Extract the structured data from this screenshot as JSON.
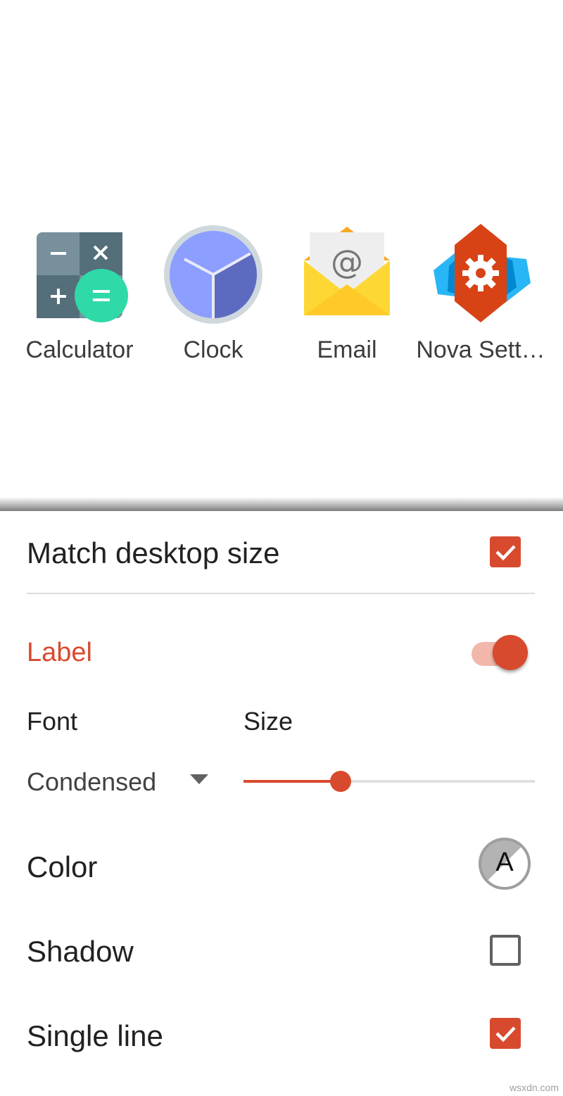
{
  "apps": [
    {
      "label": "Calculator",
      "icon": "calculator-icon"
    },
    {
      "label": "Clock",
      "icon": "clock-icon"
    },
    {
      "label": "Email",
      "icon": "email-icon"
    },
    {
      "label": "Nova Sett…",
      "icon": "nova-settings-icon"
    }
  ],
  "settings": {
    "match_desktop_size": {
      "label": "Match desktop size",
      "checked": true
    },
    "label_section": {
      "label": "Label",
      "enabled": true
    },
    "font": {
      "heading": "Font",
      "value": "Condensed",
      "icon": "dropdown-arrow-icon"
    },
    "size": {
      "heading": "Size",
      "fraction": 0.33
    },
    "color": {
      "label": "Color",
      "swatch_text": "A"
    },
    "shadow": {
      "label": "Shadow",
      "checked": false
    },
    "single_line": {
      "label": "Single line",
      "checked": true
    }
  },
  "watermark": "wsxdn.com",
  "colors": {
    "accent": "#d84a2e",
    "switch_track": "#f2b7ab",
    "text": "#212121"
  }
}
